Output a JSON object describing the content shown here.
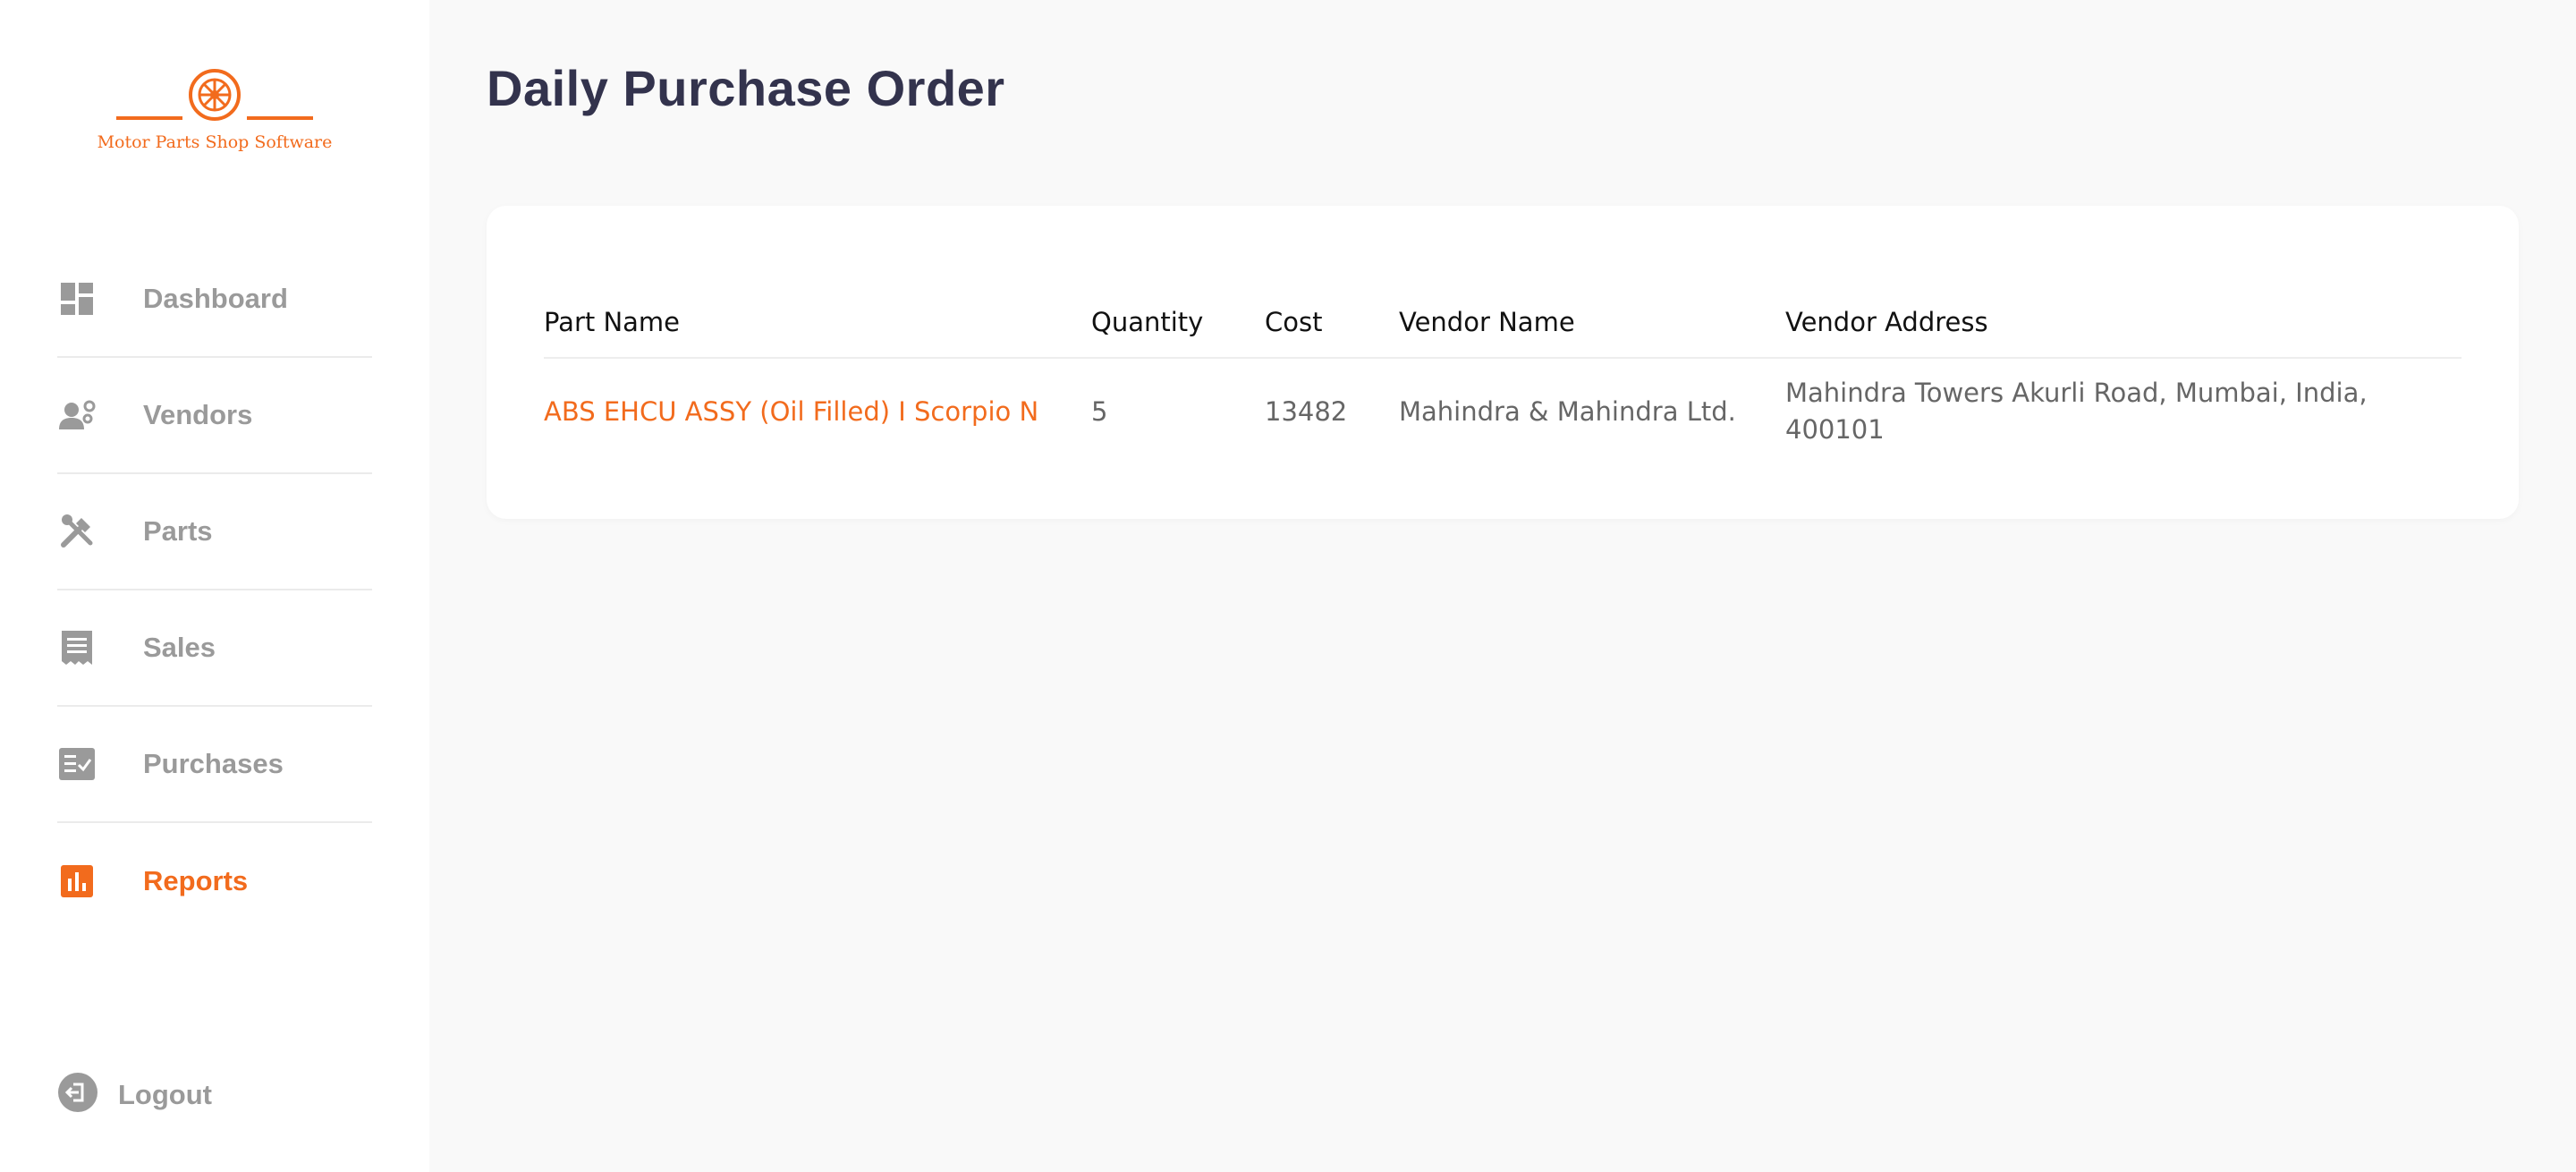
{
  "brand": {
    "name": "Motor Parts Shop Software",
    "accent_color": "#f26b1d",
    "logo_icon": "wheel-logo-icon"
  },
  "sidebar": {
    "items": [
      {
        "label": "Dashboard",
        "icon": "dashboard-icon",
        "active": false
      },
      {
        "label": "Vendors",
        "icon": "vendors-icon",
        "active": false
      },
      {
        "label": "Parts",
        "icon": "tools-icon",
        "active": false
      },
      {
        "label": "Sales",
        "icon": "receipt-icon",
        "active": false
      },
      {
        "label": "Purchases",
        "icon": "checklist-icon",
        "active": false
      },
      {
        "label": "Reports",
        "icon": "bar-chart-icon",
        "active": true
      }
    ],
    "logout": {
      "label": "Logout",
      "icon": "logout-icon"
    }
  },
  "main": {
    "title": "Daily Purchase Order",
    "table": {
      "columns": [
        "Part Name",
        "Quantity",
        "Cost",
        "Vendor Name",
        "Vendor Address"
      ],
      "rows": [
        {
          "part_name": "ABS EHCU ASSY (Oil Filled) I Scorpio N",
          "quantity": "5",
          "cost": "13482",
          "vendor_name": "Mahindra & Mahindra Ltd.",
          "vendor_address": "Mahindra Towers Akurli Road, Mumbai, India, 400101"
        }
      ]
    }
  },
  "colors": {
    "inactive_nav": "#9a9a9a",
    "title": "#33334d",
    "background": "#f9f9f9"
  }
}
